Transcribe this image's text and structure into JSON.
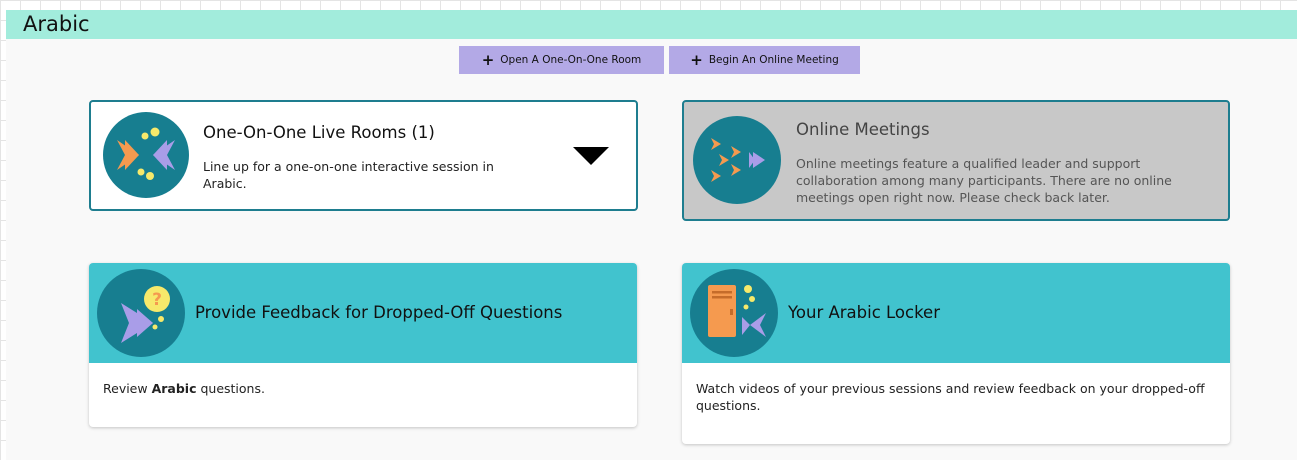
{
  "header": {
    "title": "Arabic"
  },
  "actions": {
    "open_room_label": "Open A One-On-One Room",
    "begin_meeting_label": "Begin An Online Meeting"
  },
  "cards": {
    "rooms": {
      "title": "One-On-One Live Rooms (1)",
      "description": "Line up for a one-on-one interactive session in Arabic.",
      "icon": "two-fish-icon"
    },
    "meetings": {
      "title": "Online Meetings",
      "description": "Online meetings feature a qualified leader and support collaboration among many participants. There are no online meetings open right now. Please check back later.",
      "icon": "school-of-fish-icon"
    }
  },
  "features": {
    "feedback": {
      "title": "Provide Feedback for Dropped-Off Questions",
      "body_prefix": "Review ",
      "body_bold": "Arabic",
      "body_suffix": " questions.",
      "icon": "fish-question-icon"
    },
    "locker": {
      "title": "Your Arabic Locker",
      "body": "Watch videos of your previous sessions and review feedback on your dropped-off questions.",
      "icon": "locker-fish-icon"
    }
  },
  "colors": {
    "header_bg": "#a2ecdc",
    "button_bg": "#b3a9e6",
    "card_border": "#1e7d8f",
    "icon_bg": "#177e90",
    "feature_band": "#41c3ce",
    "disabled_card_bg": "#c8c8c8"
  }
}
